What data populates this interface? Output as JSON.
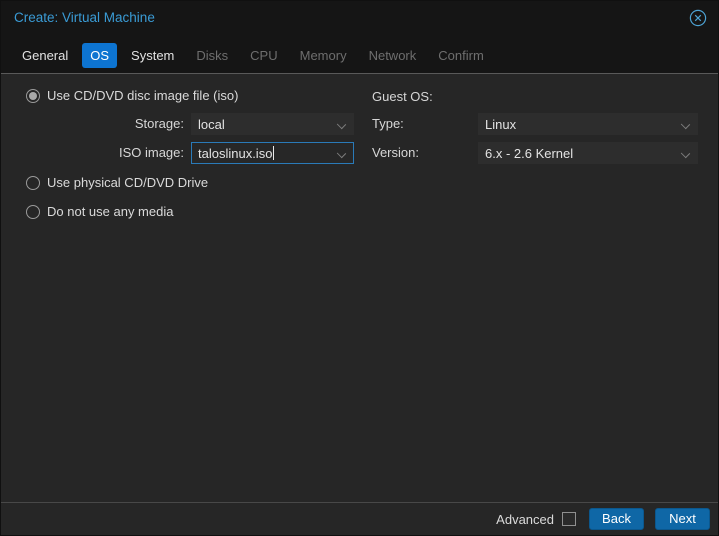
{
  "window": {
    "title": "Create: Virtual Machine"
  },
  "tabs": [
    {
      "label": "General",
      "state": "enabled"
    },
    {
      "label": "OS",
      "state": "active"
    },
    {
      "label": "System",
      "state": "enabled"
    },
    {
      "label": "Disks",
      "state": "disabled"
    },
    {
      "label": "CPU",
      "state": "disabled"
    },
    {
      "label": "Memory",
      "state": "disabled"
    },
    {
      "label": "Network",
      "state": "disabled"
    },
    {
      "label": "Confirm",
      "state": "disabled"
    }
  ],
  "form": {
    "media": {
      "options": [
        {
          "label": "Use CD/DVD disc image file (iso)",
          "selected": true
        },
        {
          "label": "Use physical CD/DVD Drive",
          "selected": false
        },
        {
          "label": "Do not use any media",
          "selected": false
        }
      ],
      "storage_label": "Storage:",
      "storage_value": "local",
      "iso_label": "ISO image:",
      "iso_value": "taloslinux.iso",
      "iso_focused": true
    },
    "guest_os": {
      "heading": "Guest OS:",
      "type_label": "Type:",
      "type_value": "Linux",
      "version_label": "Version:",
      "version_value": "6.x - 2.6 Kernel"
    }
  },
  "footer": {
    "advanced_label": "Advanced",
    "advanced_checked": false,
    "back_label": "Back",
    "next_label": "Next"
  },
  "colors": {
    "active_tab_blue": "#0d74d1",
    "button_blue": "#0f67a6",
    "title_blue": "#3a9bd5",
    "focus_border_blue": "#2a7ab8",
    "body_bg": "#262626",
    "header_bg": "#151515"
  }
}
